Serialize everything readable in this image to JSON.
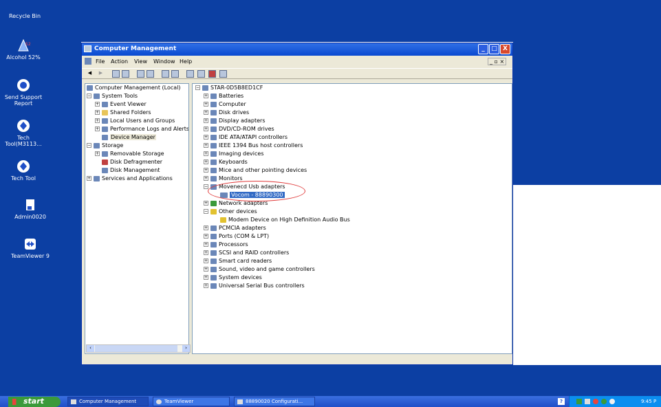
{
  "desktop": {
    "icons": [
      {
        "label": "Recycle Bin",
        "icon": "recycle-bin-icon"
      },
      {
        "label": "Alcohol 52%",
        "icon": "alcohol-icon"
      },
      {
        "label": "Send Support Report",
        "icon": "support-icon"
      },
      {
        "label": "Tech Tool(M3113...",
        "icon": "tech-tool-icon"
      },
      {
        "label": "Tech Tool",
        "icon": "tech-tool-icon"
      },
      {
        "label": "Admin0020",
        "icon": "admin-icon"
      },
      {
        "label": "TeamViewer 9",
        "icon": "teamviewer-icon"
      }
    ]
  },
  "window": {
    "title": "Computer Management",
    "menu": [
      "File",
      "Action",
      "View",
      "Window",
      "Help"
    ],
    "controls": {
      "minimize": "_",
      "maximize": "□",
      "close": "X"
    },
    "sub_controls": "_ ▫ ×"
  },
  "left_tree": [
    "Computer Management (Local)",
    "System Tools",
    "Event Viewer",
    "Shared Folders",
    "Local Users and Groups",
    "Performance Logs and Alerts",
    "Device Manager",
    "Storage",
    "Removable Storage",
    "Disk Defragmenter",
    "Disk Management",
    "Services and Applications"
  ],
  "right_tree": [
    "STAR-0D5B8ED1CF",
    "Batteries",
    "Computer",
    "Disk drives",
    "Display adapters",
    "DVD/CD-ROM drives",
    "IDE ATA/ATAPI controllers",
    "IEEE 1394 Bus host controllers",
    "Imaging devices",
    "Keyboards",
    "Mice and other pointing devices",
    "Monitors",
    "Movenecd Usb adapters",
    "Vocom - 88890300",
    "Network adapters",
    "Other devices",
    "Modem Device on High Definition Audio Bus",
    "PCMCIA adapters",
    "Ports (COM & LPT)",
    "Processors",
    "SCSI and RAID controllers",
    "Smart card readers",
    "Sound, video and game controllers",
    "System devices",
    "Universal Serial Bus controllers"
  ],
  "taskbar": {
    "start": "start",
    "tasks": [
      "Computer Management",
      "TeamViewer",
      "88890020 Configurati..."
    ],
    "clock": "9:45 P"
  }
}
